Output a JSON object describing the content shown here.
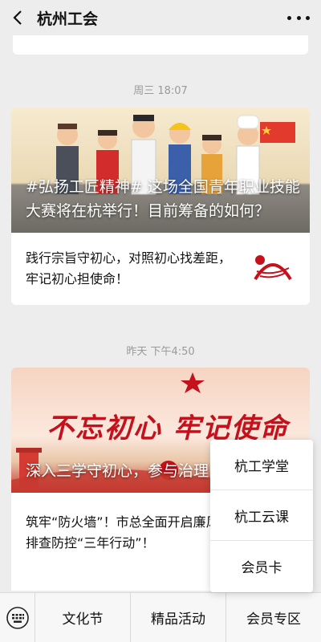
{
  "header": {
    "title": "杭州工会",
    "back_icon": "chevron-left-icon",
    "more_icon": "more-dots-icon"
  },
  "feed": {
    "messages": [
      {
        "time": "周三 18:07",
        "main_title": "#弘扬工匠精神# 这场全国青年职业技能大赛将在杭举行！目前筹备的如何？",
        "sub_title": "践行宗旨守初心，对照初心找差距，牢记初心担使命！"
      },
      {
        "time": "昨天 下午4:50",
        "banner_text": "不忘初心 牢记使命",
        "main_title": "深入三学守初心，参与治理",
        "sub_title": "筑牢“防火墙”！市总全面开启廉风险排查防控“三年行动”！"
      }
    ]
  },
  "popup_menu": {
    "items": [
      "杭工学堂",
      "杭工云课",
      "会员卡"
    ]
  },
  "bottom_menu": {
    "keyboard_icon": "keyboard-icon",
    "tabs": [
      "文化节",
      "精品活动",
      "会员专区"
    ]
  },
  "colors": {
    "background": "#ededed",
    "banner_red": "#c5111c"
  }
}
